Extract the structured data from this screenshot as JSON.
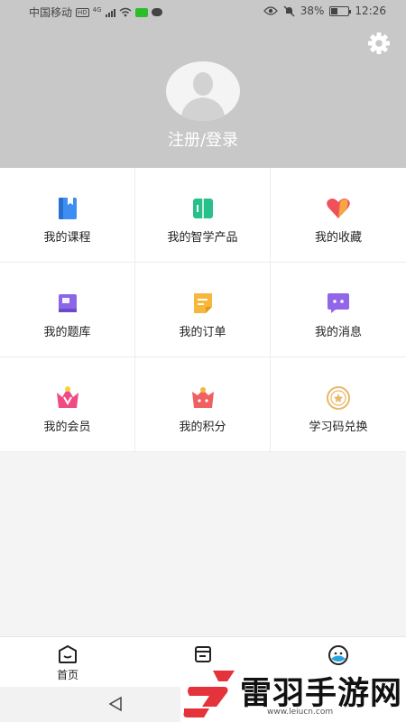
{
  "status_bar": {
    "carrier": "中国移动",
    "hd_badge": "HD",
    "network": "4G",
    "battery_percent": "38%",
    "battery_level": 0.38,
    "time": "12:26"
  },
  "header": {
    "login_label": "注册/登录"
  },
  "menu": [
    {
      "label": "我的课程",
      "icon": "course-book-icon",
      "color": "#3c8ef3"
    },
    {
      "label": "我的智学产品",
      "icon": "smart-product-icon",
      "color": "#27c08a"
    },
    {
      "label": "我的收藏",
      "icon": "heart-icon",
      "color": "#f0505a"
    },
    {
      "label": "我的题库",
      "icon": "question-bank-icon",
      "color": "#8b67e8"
    },
    {
      "label": "我的订单",
      "icon": "order-icon",
      "color": "#f6b73c"
    },
    {
      "label": "我的消息",
      "icon": "message-icon",
      "color": "#9166e8"
    },
    {
      "label": "我的会员",
      "icon": "vip-crown-icon",
      "color": "#f04a84"
    },
    {
      "label": "我的积分",
      "icon": "points-icon",
      "color": "#f06060"
    },
    {
      "label": "学习码兑换",
      "icon": "redeem-coin-icon",
      "color": "#e8b86a"
    }
  ],
  "bottom_nav": [
    {
      "label": "首页",
      "icon": "home-icon"
    },
    {
      "label": "",
      "icon": "library-icon"
    },
    {
      "label": "",
      "icon": "profile-icon"
    }
  ],
  "watermark": {
    "name": "雷羽手游网",
    "url": "www.leiucn.com"
  }
}
